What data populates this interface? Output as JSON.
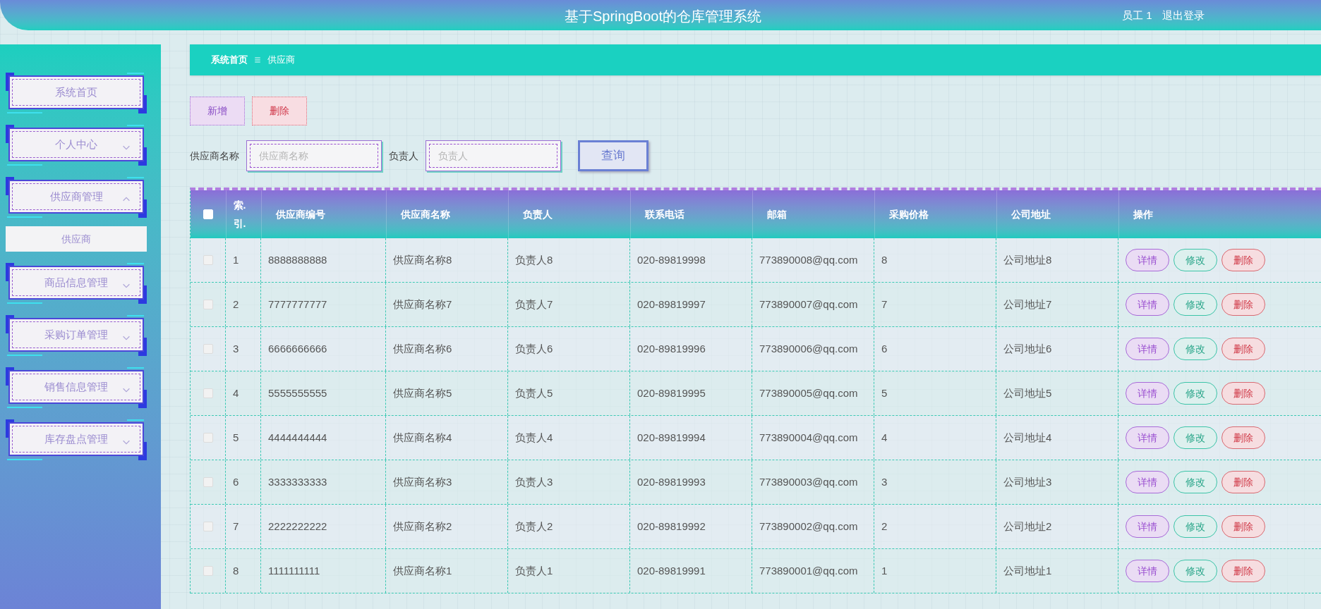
{
  "header": {
    "title": "基于SpringBoot的仓库管理系统",
    "user": "员工 1",
    "logout": "退出登录"
  },
  "sidebar": {
    "items": [
      {
        "label": "系统首页",
        "kind": "link"
      },
      {
        "label": "个人中心",
        "kind": "group",
        "expanded": false
      },
      {
        "label": "供应商管理",
        "kind": "group",
        "expanded": true,
        "children": [
          {
            "label": "供应商"
          }
        ]
      },
      {
        "label": "商品信息管理",
        "kind": "group",
        "expanded": false
      },
      {
        "label": "采购订单管理",
        "kind": "group",
        "expanded": false
      },
      {
        "label": "销售信息管理",
        "kind": "group",
        "expanded": false
      },
      {
        "label": "库存盘点管理",
        "kind": "group",
        "expanded": false
      }
    ]
  },
  "breadcrumb": [
    "系统首页",
    "供应商"
  ],
  "toolbar": {
    "buttons": [
      {
        "label": "新增",
        "kind": "add"
      },
      {
        "label": "删除",
        "kind": "delete"
      }
    ]
  },
  "search": {
    "fields": [
      {
        "label": "供应商名称",
        "placeholder": "供应商名称"
      },
      {
        "label": "负责人",
        "placeholder": "负责人"
      }
    ],
    "button": "查询"
  },
  "table": {
    "all_checked": false,
    "columns": [
      "索.引.",
      "供应商编号",
      "供应商名称",
      "负责人",
      "联系电话",
      "邮箱",
      "采购价格",
      "公司地址",
      "操作"
    ],
    "rows": [
      {
        "checked": false,
        "cells": [
          "1",
          "8888888888",
          "供应商名称8",
          "负责人8",
          "020-89819998",
          "773890008@qq.com",
          "8",
          "公司地址8"
        ],
        "actions": [
          "详情",
          "修改",
          "删除"
        ]
      },
      {
        "checked": false,
        "cells": [
          "2",
          "7777777777",
          "供应商名称7",
          "负责人7",
          "020-89819997",
          "773890007@qq.com",
          "7",
          "公司地址7"
        ],
        "actions": [
          "详情",
          "修改",
          "删除"
        ]
      },
      {
        "checked": false,
        "cells": [
          "3",
          "6666666666",
          "供应商名称6",
          "负责人6",
          "020-89819996",
          "773890006@qq.com",
          "6",
          "公司地址6"
        ],
        "actions": [
          "详情",
          "修改",
          "删除"
        ]
      },
      {
        "checked": false,
        "cells": [
          "4",
          "5555555555",
          "供应商名称5",
          "负责人5",
          "020-89819995",
          "773890005@qq.com",
          "5",
          "公司地址5"
        ],
        "actions": [
          "详情",
          "修改",
          "删除"
        ]
      },
      {
        "checked": false,
        "cells": [
          "5",
          "4444444444",
          "供应商名称4",
          "负责人4",
          "020-89819994",
          "773890004@qq.com",
          "4",
          "公司地址4"
        ],
        "actions": [
          "详情",
          "修改",
          "删除"
        ]
      },
      {
        "checked": false,
        "cells": [
          "6",
          "3333333333",
          "供应商名称3",
          "负责人3",
          "020-89819993",
          "773890003@qq.com",
          "3",
          "公司地址3"
        ],
        "actions": [
          "详情",
          "修改",
          "删除"
        ]
      },
      {
        "checked": false,
        "cells": [
          "7",
          "2222222222",
          "供应商名称2",
          "负责人2",
          "020-89819992",
          "773890002@qq.com",
          "2",
          "公司地址2"
        ],
        "actions": [
          "详情",
          "修改",
          "删除"
        ]
      },
      {
        "checked": false,
        "cells": [
          "8",
          "1111111111",
          "供应商名称1",
          "负责人1",
          "020-89819991",
          "773890001@qq.com",
          "1",
          "公司地址1"
        ],
        "actions": [
          "详情",
          "修改",
          "删除"
        ]
      }
    ]
  }
}
